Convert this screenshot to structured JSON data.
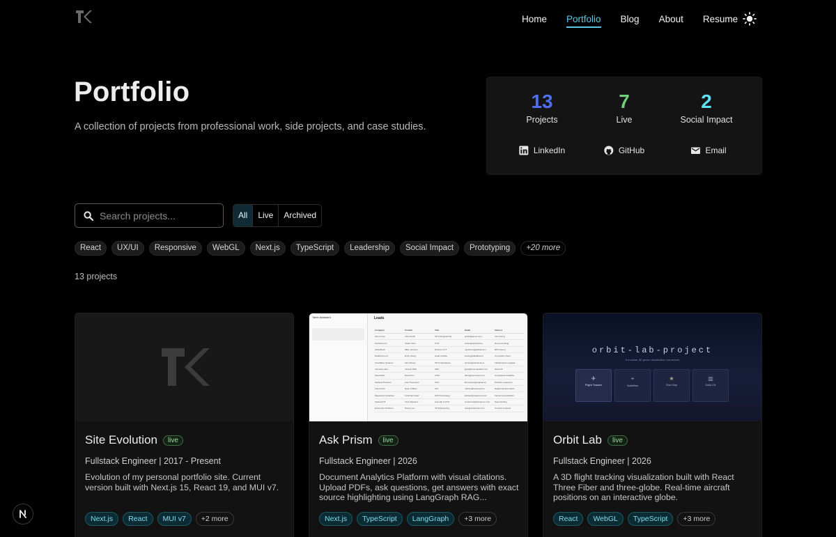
{
  "nav": {
    "items": [
      {
        "label": "Home"
      },
      {
        "label": "Portfolio",
        "active": true
      },
      {
        "label": "Blog"
      },
      {
        "label": "About"
      },
      {
        "label": "Resume"
      }
    ],
    "theme_icon": "sun-icon",
    "accent": "#5bc8e8"
  },
  "hero": {
    "title": "Portfolio",
    "subtitle": "A collection of projects from professional work, side projects, and case studies."
  },
  "stats": [
    {
      "value": "13",
      "label": "Projects",
      "color": "#4f6ff0"
    },
    {
      "value": "7",
      "label": "Live",
      "color": "#6fcf7a"
    },
    {
      "value": "2",
      "label": "Social Impact",
      "color": "#5ee0f0"
    }
  ],
  "links": [
    {
      "label": "LinkedIn",
      "icon": "linkedin-icon"
    },
    {
      "label": "GitHub",
      "icon": "github-icon"
    },
    {
      "label": "Email",
      "icon": "email-icon"
    }
  ],
  "search": {
    "placeholder": "Search projects..."
  },
  "filters": [
    {
      "label": "All",
      "active": true
    },
    {
      "label": "Live"
    },
    {
      "label": "Archived"
    }
  ],
  "tags": [
    "React",
    "UX/UI",
    "Responsive",
    "WebGL",
    "Next.js",
    "TypeScript",
    "Leadership",
    "Social Impact",
    "Prototyping"
  ],
  "tags_more": "+20 more",
  "count_label": "13 projects",
  "projects": [
    {
      "title": "Site Evolution",
      "status": "live",
      "role": "Fullstack Engineer | 2017 - Present",
      "description": "Evolution of my personal portfolio site. Current version built with Next.js 15, React 19, and MUI v7.",
      "chips": [
        "Next.js",
        "React",
        "MUI v7"
      ],
      "more": "+2 more"
    },
    {
      "title": "Ask Prism",
      "status": "live",
      "role": "Fullstack Engineer | 2026",
      "description": "Document Analytics Platform with visual citations. Upload PDFs, ask questions, get answers with exact source highlighting using LangGraph RAG...",
      "chips": [
        "Next.js",
        "TypeScript",
        "LangGraph"
      ],
      "more": "+3 more",
      "thumb": {
        "sidebar_title": "Table Assistant",
        "heading": "Leads",
        "columns": [
          "Company",
          "Contact",
          "Title",
          "Email",
          "Interest"
        ],
        "rows": [
          [
            "Acme Corp",
            "John Smith",
            "VP of Engineering",
            "jsmith@acme.com",
            "use pricing"
          ],
          [
            "TechStart Inc",
            "Sarah Chen",
            "CTO",
            "schen@techstart.io",
            "Recent funding"
          ],
          [
            "GlobalTech",
            "Mike Johnson",
            "Director of IT",
            "mjohnson@global.com",
            "RFP issued"
          ],
          [
            "DataFlow LLC",
            "Emily Wong",
            "Head of Data",
            "ewong@dataflow.co",
            "Competitor churn"
          ],
          [
            "CloudNine Systems",
            "Alex Rivera",
            "VP of Operations",
            "arivera@cloudnine.io",
            "Infrastructure upgrade"
          ],
          [
            "Innovate Labs",
            "Jessica Park",
            "CEO",
            "jpark@innovatelabs.com",
            "Series B"
          ],
          [
            "SecureNet",
            "David Kim",
            "CISO",
            "dkim@securenet.com",
            "Compliance deadline"
          ],
          [
            "ScaleUp Partners",
            "Lisa Thompson",
            "CFO",
            "lthompson@scaleup.co",
            "Portfolio expansion"
          ],
          [
            "FutureTech",
            "Ryan O'Brien",
            "CIO",
            "robrien@futuretech.io",
            "Digital transformation"
          ],
          [
            "MegaCorp Industries",
            "Amanda Foster",
            "SVP Technology",
            "afoster@megacorp.com",
            "Vendor consolidation"
          ],
          [
            "StartupXYZ",
            "Chris Martinez",
            "Founder & CTO",
            "cmartinez@startupxyz.com",
            "Seed funding"
          ],
          [
            "Enterprise Solutions",
            "Nancy Lee",
            "VP Engineering",
            "nlee@enterprise.com",
            "Contract renewal"
          ]
        ]
      }
    },
    {
      "title": "Orbit Lab",
      "status": "live",
      "role": "Fullstack Engineer | 2026",
      "description": "A 3D flight tracking visualization built with React Three Fiber and three-globe. Real-time aircraft positions on an interactive globe.",
      "chips": [
        "React",
        "WebGL",
        "TypeScript"
      ],
      "more": "+3 more",
      "thumb": {
        "heading": "orbit-lab-project",
        "subheading": "A modular 3D globe visualization framework",
        "tiles": [
          {
            "label": "Flight Tracker",
            "icon": "plane-icon"
          },
          {
            "label": "Satellites",
            "icon": "satellite-icon"
          },
          {
            "label": "Star Map",
            "icon": "star-icon"
          },
          {
            "label": "Data Viz",
            "icon": "chart-icon"
          }
        ]
      }
    }
  ]
}
